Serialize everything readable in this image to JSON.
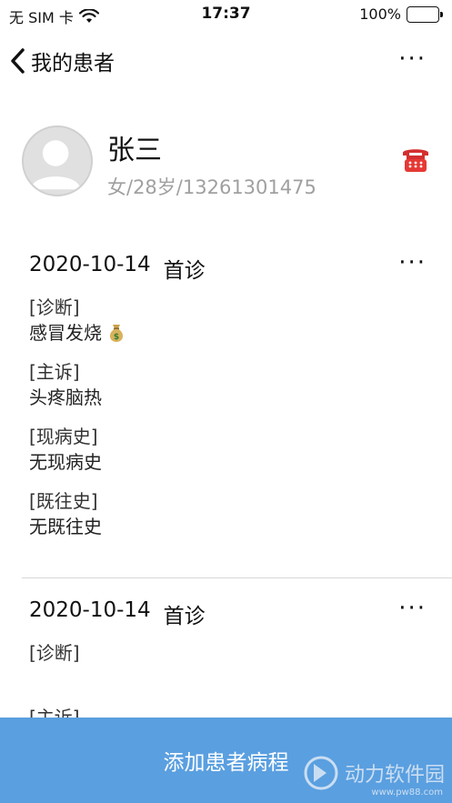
{
  "status_bar": {
    "carrier": "无 SIM 卡",
    "time": "17:37",
    "battery": "100%",
    "battery_level": 1.0
  },
  "nav": {
    "back_label": "我的患者",
    "more": "···"
  },
  "patient": {
    "name": "张三",
    "info": "女/28岁/13261301475"
  },
  "records": [
    {
      "date": "2020-10-14",
      "type": "首诊",
      "more": "···",
      "fields": [
        {
          "label": "[诊断]",
          "value": "感冒发烧"
        },
        {
          "label": "[主诉]",
          "value": "头疼脑热"
        },
        {
          "label": "[现病史]",
          "value": "无现病史"
        },
        {
          "label": "[既往史]",
          "value": "无既往史"
        }
      ]
    },
    {
      "date": "2020-10-14",
      "type": "首诊",
      "more": "···",
      "fields": [
        {
          "label": "[诊断]",
          "value": ""
        },
        {
          "label": "[主诉]",
          "value": ""
        }
      ]
    }
  ],
  "add_button": "添加患者病程",
  "watermark": {
    "text": "动力软件园",
    "url": "www.pw88.com"
  },
  "colors": {
    "accent": "#5a9fe0",
    "battery": "#4cd964",
    "muted_text": "#a0a0a0"
  }
}
